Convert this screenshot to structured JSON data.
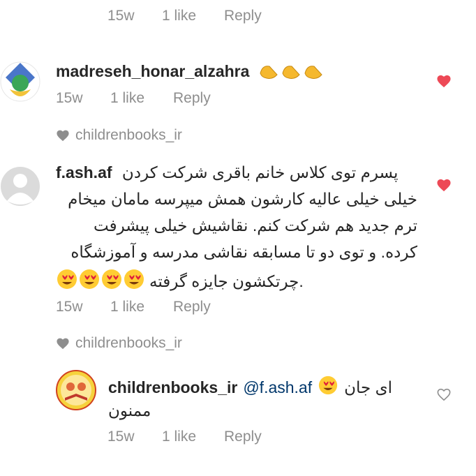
{
  "top_reply": {
    "age": "15w",
    "likes": "1 like",
    "reply": "Reply"
  },
  "comments": [
    {
      "username": "madreseh_honar_alzahra",
      "age": "15w",
      "likes": "1 like",
      "reply": "Reply",
      "liked": true,
      "liked_by": "childrenbooks_ir"
    },
    {
      "username": "f.ash.af",
      "text_lines": [
        "پسرم توی کلاس خانم باقری شرکت کردن",
        "خیلی خیلی عالیه کارشون همش میپرسه مامان میخام",
        "ترم جدید هم شرکت کنم. نقاشیش خیلی پیشرفت",
        "کرده. و توی دو تا مسابقه نقاشی مدرسه و آموزشگاه",
        ".چرتکشون جایزه گرفته"
      ],
      "age": "15w",
      "likes": "1 like",
      "reply": "Reply",
      "liked": true,
      "liked_by": "childrenbooks_ir"
    }
  ],
  "reply_comment": {
    "username": "childrenbooks_ir",
    "mention": "@f.ash.af",
    "text_line1": "ای جان",
    "text_line2": "ممنون",
    "age": "15w",
    "likes": "1 like",
    "reply": "Reply",
    "liked": false
  },
  "colors": {
    "heart_red": "#ed4956",
    "meta_gray": "#8e8e8e",
    "mention_blue": "#00376b"
  },
  "icons": [
    "clapping-hands-icon",
    "heart-eyes-emoji-icon",
    "heart-icon",
    "heart-outline-icon",
    "avatar"
  ]
}
